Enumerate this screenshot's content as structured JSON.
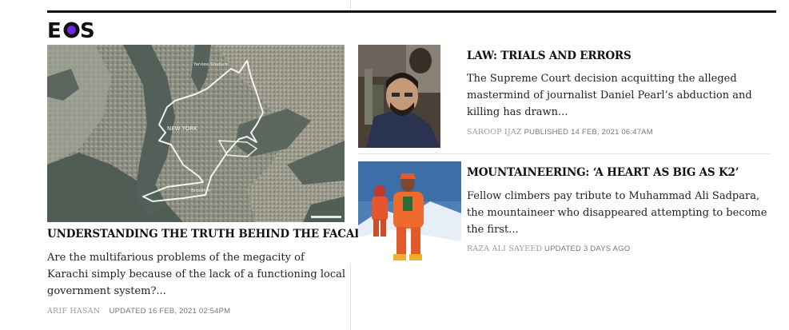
{
  "brand": {
    "logo_text": "EOS",
    "accent": "#6a2bd8"
  },
  "lead_story": {
    "title": "UNDERSTANDING THE TRUTH BEHIND THE FACADE",
    "excerpt": "Are the multifarious problems of the megacity of Karachi simply because of the lack of a functioning local government system?...",
    "author": "ARIF HASAN",
    "timestamp": "UPDATED 16 FEB, 2021 02:54PM",
    "image_labels": {
      "city": "NEW YORK",
      "area1": "Yankee Stadium",
      "area2": "Brooklyn"
    }
  },
  "stories": [
    {
      "title": "LAW: TRIALS AND ERRORS",
      "excerpt": "The Supreme Court decision acquitting the alleged mastermind of journalist Daniel Pearl’s abduction and killing has drawn...",
      "author": "SAROOP IJAZ",
      "timestamp": "PUBLISHED 14 FEB, 2021 06:47AM"
    },
    {
      "title": "MOUNTAINEERING: ‘A HEART AS BIG AS K2’",
      "excerpt": "Fellow climbers pay tribute to Muhammad Ali Sadpara, the mountaineer who disappeared attempting to become the first...",
      "author": "RAZA ALI SAYEED",
      "timestamp": "UPDATED 3 DAYS AGO"
    }
  ]
}
